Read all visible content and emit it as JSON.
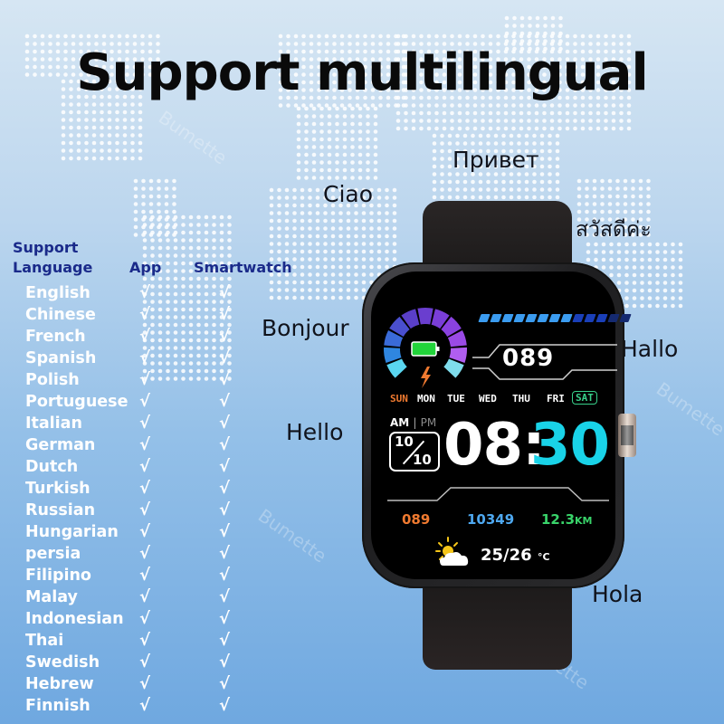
{
  "title": "Support multilingual",
  "greetings": {
    "russian": "Привет",
    "italian": "Ciao",
    "thai": "สวัสดีค่ะ",
    "french": "Bonjour",
    "german": "Hallo",
    "english": "Hello",
    "spanish": "Hola"
  },
  "table": {
    "header_language_line1": "Support",
    "header_language_line2": "Language",
    "header_app": "App",
    "header_smartwatch": "Smartwatch",
    "check_glyph": "√",
    "rows": [
      {
        "language": "English",
        "app": true,
        "smartwatch": true
      },
      {
        "language": "Chinese",
        "app": true,
        "smartwatch": true
      },
      {
        "language": "French",
        "app": true,
        "smartwatch": true
      },
      {
        "language": "Spanish",
        "app": true,
        "smartwatch": true
      },
      {
        "language": "Polish",
        "app": true,
        "smartwatch": true
      },
      {
        "language": "Portuguese",
        "app": true,
        "smartwatch": true
      },
      {
        "language": "Italian",
        "app": true,
        "smartwatch": true
      },
      {
        "language": "German",
        "app": true,
        "smartwatch": true
      },
      {
        "language": "Dutch",
        "app": true,
        "smartwatch": true
      },
      {
        "language": "Turkish",
        "app": true,
        "smartwatch": true
      },
      {
        "language": "Russian",
        "app": true,
        "smartwatch": true
      },
      {
        "language": "Hungarian",
        "app": true,
        "smartwatch": true
      },
      {
        "language": "persia",
        "app": true,
        "smartwatch": true
      },
      {
        "language": "Filipino",
        "app": true,
        "smartwatch": true
      },
      {
        "language": "Malay",
        "app": true,
        "smartwatch": true
      },
      {
        "language": "Indonesian",
        "app": true,
        "smartwatch": true
      },
      {
        "language": "Thai",
        "app": true,
        "smartwatch": true
      },
      {
        "language": "Swedish",
        "app": true,
        "smartwatch": true
      },
      {
        "language": "Hebrew",
        "app": true,
        "smartwatch": true
      },
      {
        "language": "Finnish",
        "app": true,
        "smartwatch": true
      }
    ]
  },
  "watch": {
    "top_value": "089",
    "signal_segments_total": 13,
    "signal_segments_lit": 8,
    "battery_icon": "battery-full-icon",
    "charge_icon": "lightning-icon",
    "days": [
      "SUN",
      "MON",
      "TUE",
      "WED",
      "THU",
      "FRI",
      "SAT"
    ],
    "active_day": "SAT",
    "am_label": "AM",
    "separator": "|",
    "pm_label": "PM",
    "date_top": "10",
    "date_bottom": "10",
    "time_hours": "08:",
    "time_minutes": "30",
    "heart_rate": "089",
    "steps": "10349",
    "distance": "12.3",
    "distance_unit": "KM",
    "weather_icon": "partly-sunny-icon",
    "temperature": "25/26",
    "temperature_unit": "°C"
  },
  "watermark": "Bumette",
  "colors": {
    "header_blue": "#1a2a8a",
    "time_minutes": "#19d3e8",
    "heart_rate": "#f07a30",
    "steps": "#4ea8f0",
    "distance": "#39d36a",
    "sunday": "#f07a30",
    "saturday": "#38d08a",
    "battery": "#22d43a"
  }
}
